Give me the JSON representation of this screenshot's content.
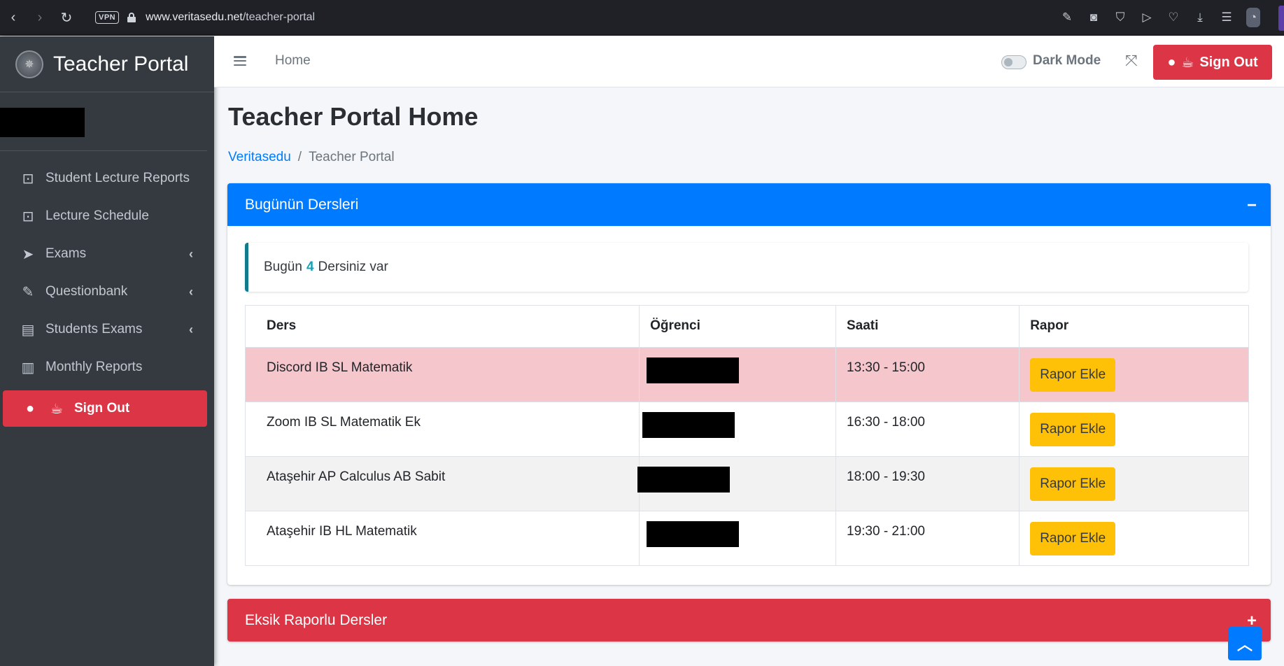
{
  "browser": {
    "vpn_label": "VPN",
    "url_host": "www.veritasedu.net",
    "url_path": "/teacher-portal"
  },
  "sidebar": {
    "brand": "Teacher Portal",
    "items": [
      {
        "label": "Student Lecture Reports",
        "icon": "chalkboard-teacher-icon"
      },
      {
        "label": "Lecture Schedule",
        "icon": "chalkboard-teacher-icon"
      },
      {
        "label": "Exams",
        "icon": "paper-plane-icon"
      },
      {
        "label": "Questionbank",
        "icon": "edit-icon"
      },
      {
        "label": "Students Exams",
        "icon": "id-card-icon"
      },
      {
        "label": "Monthly Reports",
        "icon": "book-icon"
      }
    ],
    "signout_label": "Sign Out"
  },
  "navbar": {
    "home": "Home",
    "dark_mode": "Dark Mode",
    "signout_label": "Sign Out"
  },
  "page": {
    "title": "Teacher Portal Home",
    "breadcrumb": [
      "Veritasedu",
      "Teacher Portal"
    ]
  },
  "today_card": {
    "title": "Bugünün Dersleri",
    "tool_icon": "minus-icon",
    "callout_prefix": "Bugün",
    "callout_count": "4",
    "callout_suffix": "Dersiniz var",
    "headers": [
      "Ders",
      "Öğrenci",
      "Saati",
      "Rapor"
    ],
    "rows": [
      {
        "ders": "Discord IB SL Matematik",
        "saati": "13:30 - 15:00",
        "rapor": "Rapor Ekle",
        "status": "danger"
      },
      {
        "ders": "Zoom IB SL Matematik Ek",
        "saati": "16:30 - 18:00",
        "rapor": "Rapor Ekle",
        "status": "normal"
      },
      {
        "ders": "Ataşehir AP Calculus AB Sabit",
        "saati": "18:00 - 19:30",
        "rapor": "Rapor Ekle",
        "status": "striped"
      },
      {
        "ders": "Ataşehir IB HL Matematik",
        "saati": "19:30 - 21:00",
        "rapor": "Rapor Ekle",
        "status": "normal"
      }
    ]
  },
  "missing_card": {
    "title": "Eksik Raporlu Dersler",
    "tool_icon": "plus-icon"
  },
  "colors": {
    "primary": "#007bff",
    "danger": "#dc3545",
    "warning": "#ffc107",
    "info": "#17a2b8",
    "sidebar": "#343a40"
  }
}
